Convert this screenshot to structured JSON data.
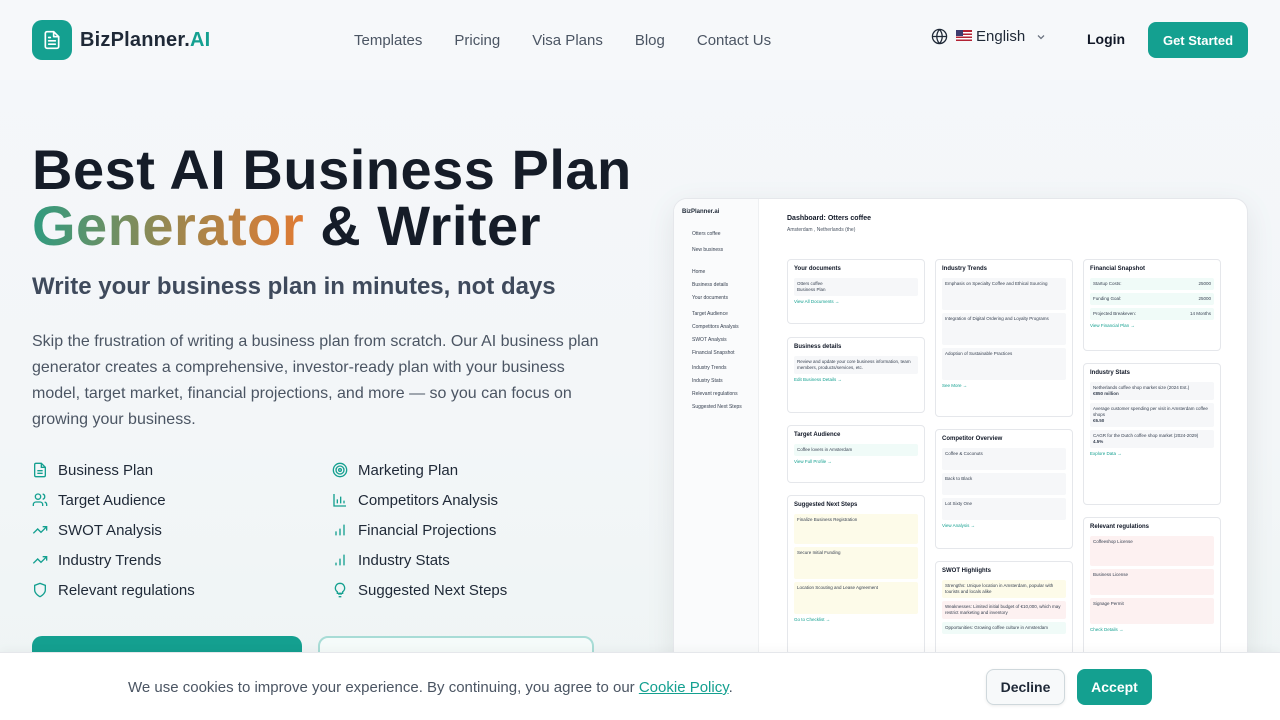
{
  "nav": {
    "brand_main": "BizPlanner.",
    "brand_ai": "AI",
    "links": [
      "Templates",
      "Pricing",
      "Visa Plans",
      "Blog",
      "Contact Us"
    ],
    "language": "English",
    "login": "Login",
    "get_started": "Get Started"
  },
  "hero": {
    "title_line1": "Best AI Business Plan",
    "title_gradient": "Generator",
    "title_rest": " & Writer",
    "subtitle": "Write your business plan in minutes, not days",
    "description": "Skip the frustration of writing a business plan from scratch. Our AI business plan generator creates a comprehensive, investor-ready plan with your business model, target market, financial projections, and more — so you can focus on growing your business.",
    "features": [
      {
        "label": "Business Plan",
        "icon": "document-icon"
      },
      {
        "label": "Marketing Plan",
        "icon": "target-icon"
      },
      {
        "label": "Target Audience",
        "icon": "users-icon"
      },
      {
        "label": "Competitors Analysis",
        "icon": "bar-chart-icon"
      },
      {
        "label": "SWOT Analysis",
        "icon": "trend-icon"
      },
      {
        "label": "Financial Projections",
        "icon": "bar-chart-icon"
      },
      {
        "label": "Industry Trends",
        "icon": "trend-icon"
      },
      {
        "label": "Industry Stats",
        "icon": "bar-chart-icon"
      },
      {
        "label": "Relevant regulations",
        "icon": "shield-icon"
      },
      {
        "label": "Suggested Next Steps",
        "icon": "lightbulb-icon"
      }
    ]
  },
  "mock": {
    "brand": "BizPlanner.ai",
    "project": "Otters coffee",
    "new_business": "New business",
    "side_items": [
      "Home",
      "Business details",
      "Your documents",
      "Target Audience",
      "Competitors Analysis",
      "SWOT Analysis",
      "Financial Snapshot",
      "Industry Trends",
      "Industry Stats",
      "Relevant regulations",
      "Suggested Next Steps"
    ],
    "title": "Dashboard: Otters coffee",
    "location": "Amsterdam , Netherlands (the)",
    "docs": {
      "h": "Your documents",
      "row1": "Otters coffee",
      "row2": "Business Plan",
      "link": "View All Documents →"
    },
    "details": {
      "h": "Business details",
      "text": "Review and update your core business information, team members, products/services, etc.",
      "link": "Edit Business Details →"
    },
    "audience": {
      "h": "Target Audience",
      "row": "Coffee lovers in Amsterdam",
      "link": "View Full Profile →"
    },
    "steps": {
      "h": "Suggested Next Steps",
      "rows": [
        "Finalize Business Registration",
        "Secure Initial Funding",
        "Location Scouting and Lease Agreement"
      ],
      "link": "Go to Checklist →"
    },
    "trends": {
      "h": "Industry Trends",
      "rows": [
        "Emphasis on Specialty Coffee and Ethical Sourcing",
        "Integration of Digital Ordering and Loyalty Programs",
        "Adoption of Sustainable Practices"
      ],
      "link": "See More →"
    },
    "competitors": {
      "h": "Competitor Overview",
      "rows": [
        "Coffee & Coconuts",
        "Back to Black",
        "Lot Sixty One"
      ],
      "link": "View Analysis →"
    },
    "swot": {
      "h": "SWOT Highlights",
      "rows": [
        "Strengths: Unique location in Amsterdam, popular with tourists and locals alike",
        "Weaknesses: Limited initial budget of €10,000, which may restrict marketing and inventory",
        "Opportunities: Growing coffee culture in Amsterdam"
      ]
    },
    "finance": {
      "h": "Financial Snapshot",
      "rows": [
        [
          "Startup Costs:",
          "25000"
        ],
        [
          "Funding Goal:",
          "25000"
        ],
        [
          "Projected Breakeven:",
          "14 Months"
        ]
      ],
      "link": "View Financial Plan →"
    },
    "stats": {
      "h": "Industry Stats",
      "rows": [
        [
          "Netherlands coffee shop market size (2024 Est.)",
          "€850 million"
        ],
        [
          "Average customer spending per visit in Amsterdam coffee shops",
          "€6.50"
        ],
        [
          "CAGR for the Dutch coffee shop market (2024-2029)",
          "4.5%"
        ]
      ],
      "link": "Explore Data →"
    },
    "regs": {
      "h": "Relevant regulations",
      "rows": [
        "Coffeeshop License",
        "Business License",
        "Signage Permit"
      ],
      "link": "Check Details →"
    }
  },
  "cookie": {
    "text": "We use cookies to improve your experience. By continuing, you agree to our ",
    "link": "Cookie Policy",
    "end": ".",
    "decline": "Decline",
    "accept": "Accept"
  },
  "colors": {
    "brand": "#14a090",
    "dark": "#151c28"
  }
}
